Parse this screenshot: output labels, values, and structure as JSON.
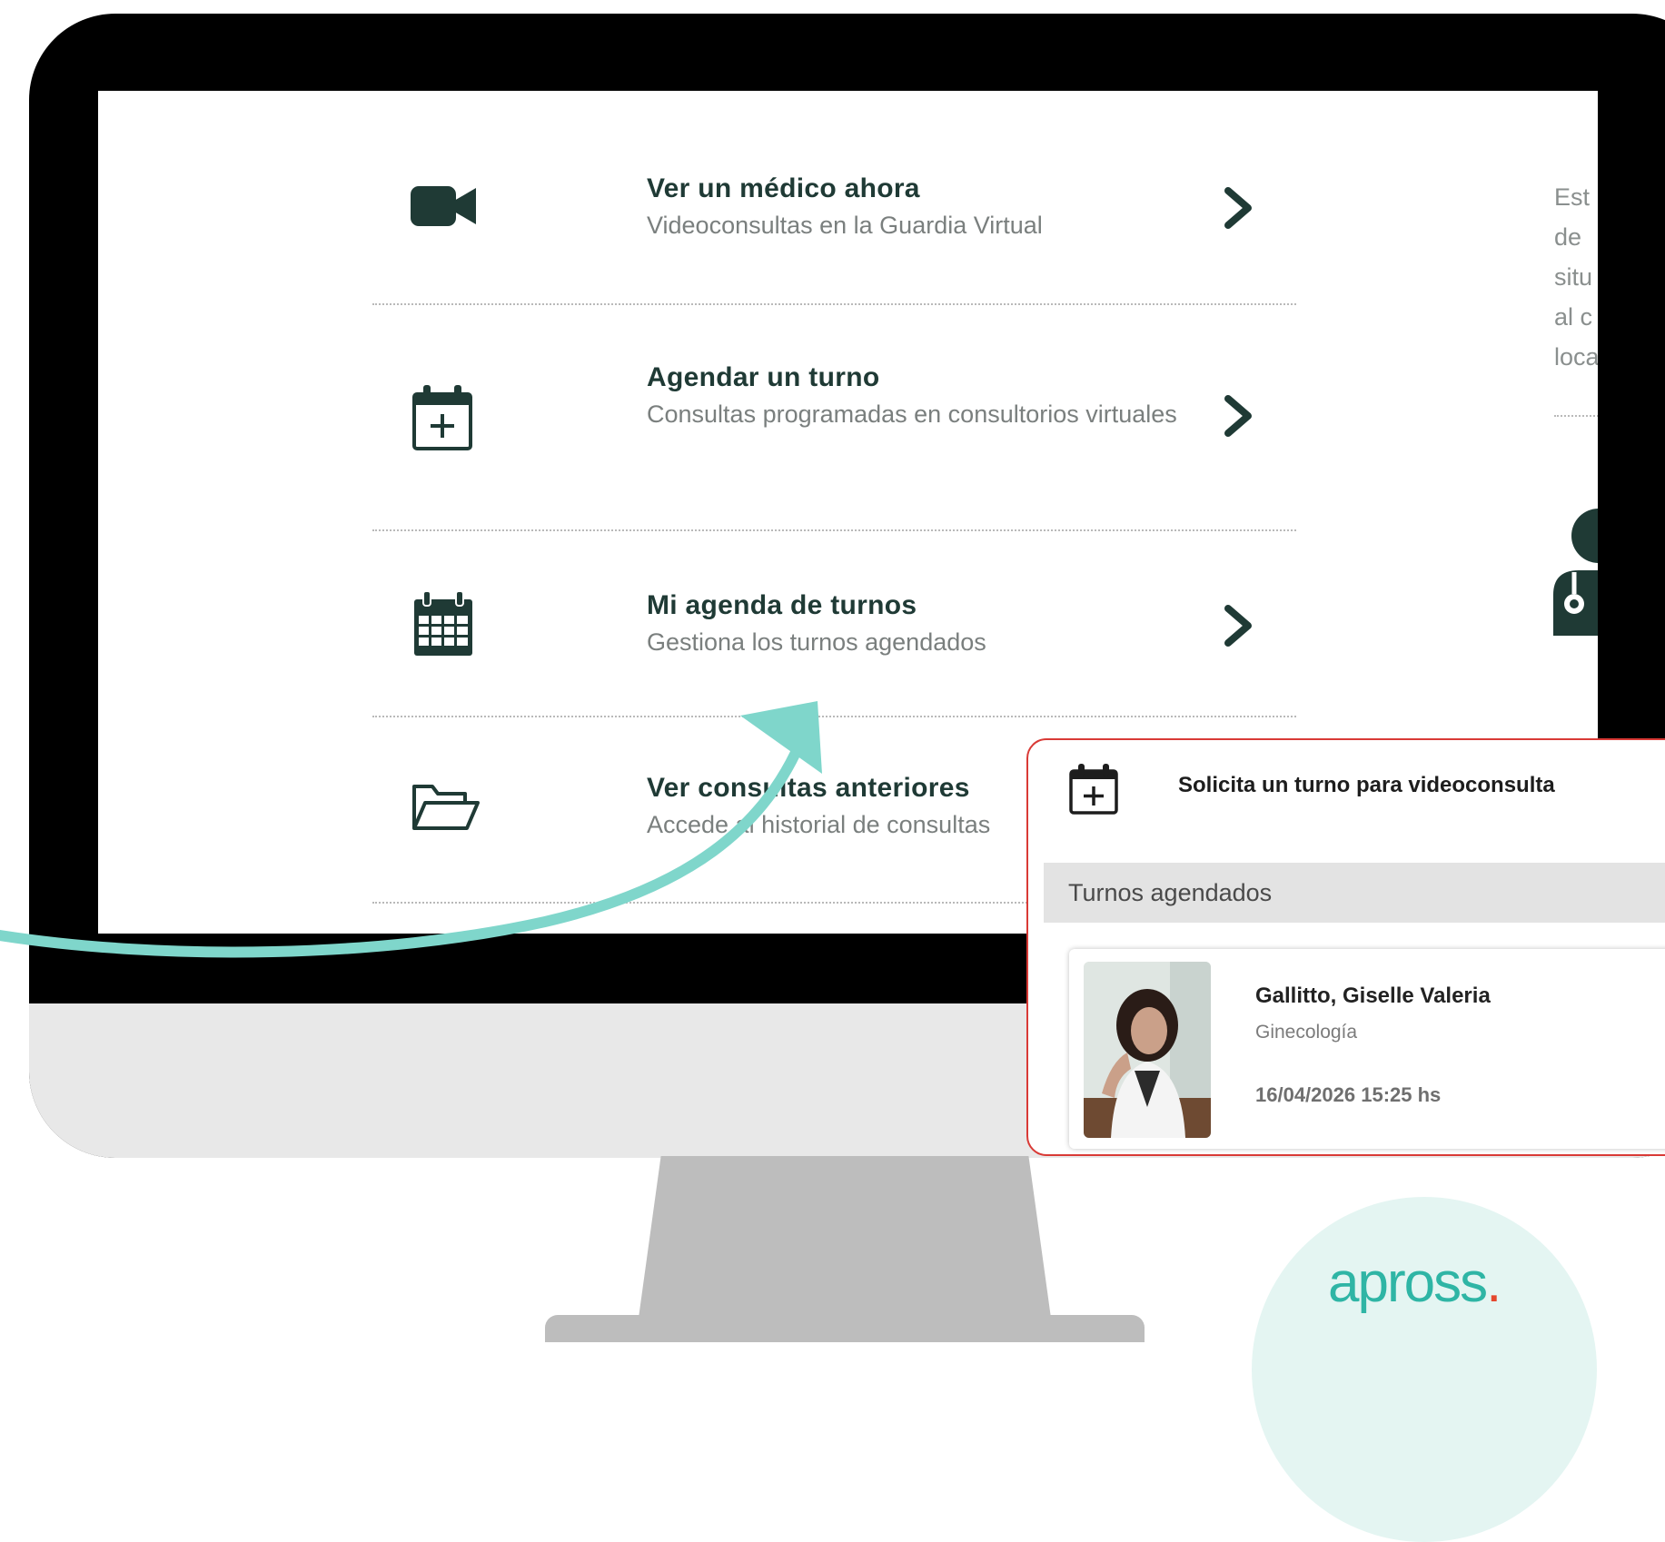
{
  "menu": {
    "items": [
      {
        "title": "Ver un médico ahora",
        "subtitle": "Videoconsultas en la Guardia Virtual",
        "icon": "video-camera-icon"
      },
      {
        "title": "Agendar un turno",
        "subtitle": "Consultas programadas en consultorios virtuales",
        "icon": "calendar-plus-icon"
      },
      {
        "title": "Mi agenda de turnos",
        "subtitle": "Gestiona los turnos agendados",
        "icon": "calendar-grid-icon"
      },
      {
        "title": "Ver consultas anteriores",
        "subtitle": "Accede al historial de consultas",
        "icon": "folder-open-icon"
      }
    ]
  },
  "side_panel": {
    "lines": [
      "Est",
      "de",
      "situ",
      "al c",
      "loca"
    ]
  },
  "popup": {
    "request_label": "Solicita un turno para videoconsulta",
    "section_title": "Turnos agendados",
    "appointment": {
      "doctor_name": "Gallitto, Giselle Valeria",
      "specialty": "Ginecología",
      "datetime": "16/04/2026 15:25 hs"
    }
  },
  "brand": {
    "logo_text": "apross",
    "logo_dot": ".",
    "colors": {
      "primary_dark": "#1f3a35",
      "accent_teal": "#7fd6cb",
      "logo_teal": "#2fb5a5",
      "logo_red": "#e4472d",
      "popup_border": "#d93a36"
    }
  }
}
